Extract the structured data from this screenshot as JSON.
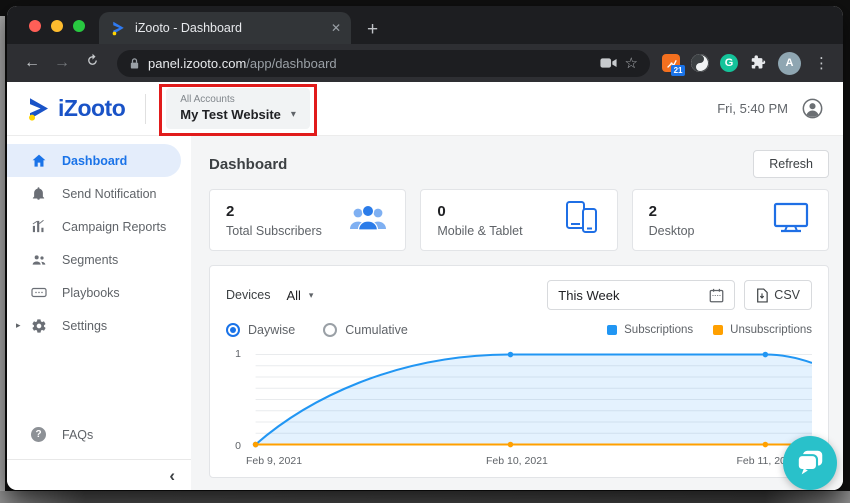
{
  "browser": {
    "tab_title": "iZooto - Dashboard",
    "url_host": "panel.izooto.com",
    "url_path": "/app/dashboard",
    "extension_badge": "21",
    "grammarly_letter": "G",
    "avatar_letter": "A"
  },
  "glyphs": {
    "close": "✕",
    "new_tab": "+",
    "back": "←",
    "forward": "→",
    "menu": "⋮",
    "caret_down": "▾",
    "caret_right": "▸",
    "collapse": "‹",
    "star": "☆",
    "question": "?"
  },
  "header": {
    "logo_text": "iZooto",
    "account_label": "All Accounts",
    "account_name": "My Test Website",
    "datetime": "Fri, 5:40 PM"
  },
  "sidebar": {
    "items": [
      {
        "label": "Dashboard"
      },
      {
        "label": "Send Notification"
      },
      {
        "label": "Campaign Reports"
      },
      {
        "label": "Segments"
      },
      {
        "label": "Playbooks"
      },
      {
        "label": "Settings"
      }
    ],
    "faqs_label": "FAQs"
  },
  "main": {
    "page_title": "Dashboard",
    "refresh_label": "Refresh",
    "stats": [
      {
        "value": "2",
        "label": "Total Subscribers",
        "icon": "subscribers-group-icon"
      },
      {
        "value": "0",
        "label": "Mobile & Tablet",
        "icon": "mobile-tablet-icon"
      },
      {
        "value": "2",
        "label": "Desktop",
        "icon": "desktop-monitor-icon"
      }
    ],
    "filters": {
      "devices_label": "Devices",
      "devices_value": "All",
      "date_range": "This Week",
      "csv_label": "CSV",
      "view_options": [
        {
          "label": "Daywise",
          "selected": true
        },
        {
          "label": "Cumulative",
          "selected": false
        }
      ]
    }
  },
  "chart_data": {
    "type": "area",
    "x": [
      "Feb 9, 2021",
      "Feb 10, 2021",
      "Feb 11, 2021"
    ],
    "series": [
      {
        "name": "Subscriptions",
        "color": "#2196f3",
        "values": [
          0,
          1,
          1
        ]
      },
      {
        "name": "Unsubscriptions",
        "color": "#ffa000",
        "values": [
          0,
          0,
          0
        ]
      }
    ],
    "y_ticks": [
      "1",
      "0"
    ],
    "ylim": [
      0,
      1
    ],
    "grid": true,
    "gridline_count": 9,
    "legend_position": "top-right"
  },
  "colors": {
    "accent_blue": "#1a73e8",
    "logo_blue": "#1a53c7",
    "logo_dot_yellow": "#ffd400",
    "annotation_red": "#e11b1b",
    "chat_teal": "#29c1ca",
    "stat_icon_blue": "#1f6fe5"
  }
}
